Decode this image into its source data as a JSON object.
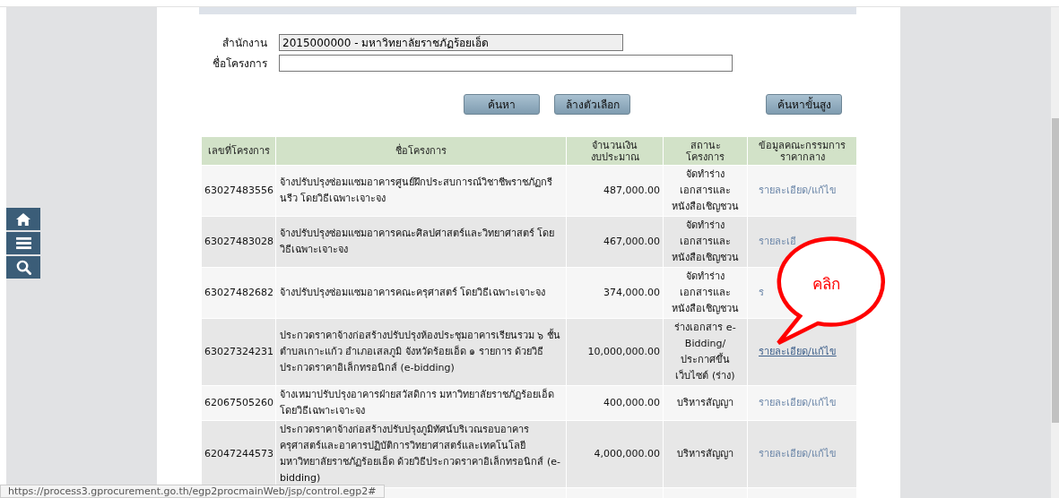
{
  "side_nav": [
    {
      "kind": "home"
    },
    {
      "kind": "menu"
    },
    {
      "kind": "search"
    }
  ],
  "search_form": {
    "fields": [
      {
        "label": "สำนักงาน",
        "value": "2015000000 - มหาวิทยาลัยราชภัฏร้อยเอ็ด",
        "readonly": true
      },
      {
        "label": "ชื่อโครงการ",
        "readonly": false
      }
    ],
    "buttons": [
      "ค้นหา",
      "ล้างตัวเลือก",
      "ค้นหาขั้นสูง"
    ]
  },
  "table": {
    "columns": [
      "เลขที่โครงการ",
      "ชื่อโครงการ",
      "จำนวนเงิน\nงบประมาณ",
      "สถานะ\nโครงการ",
      "ข้อมูลคณะกรรมการ\nราคากลาง"
    ],
    "rows": [
      {
        "id": "63027483556",
        "name": "จ้างปรับปรุงซ่อมแซมอาคารศูนย์ฝึกประสบการณ์วิชาชีพราชภัฏกรีนรีว โดยวิธีเฉพาะเจาะจง",
        "budget": "487,000.00",
        "status": "จัดทำร่าง\nเอกสารและ\nหนังสือเชิญชวน",
        "link": {
          "text": "รายละเอียด/แก้ไข",
          "hovered": false
        }
      },
      {
        "id": "63027483028",
        "name": "จ้างปรับปรุงซ่อมแซมอาคารคณะศิลปศาสตร์และวิทยาศาสตร์ โดยวิธีเฉพาะเจาะจง",
        "budget": "467,000.00",
        "status": "จัดทำร่าง\nเอกสารและ\nหนังสือเชิญชวน",
        "link": {
          "text": "รายละเอี",
          "hovered": false
        }
      },
      {
        "id": "63027482682",
        "name": "จ้างปรับปรุงซ่อมแซมอาคารคณะครุศาสตร์ โดยวิธีเฉพาะเจาะจง",
        "budget": "374,000.00",
        "status": "จัดทำร่าง\nเอกสารและ\nหนังสือเชิญชวน",
        "link": {
          "text": "ร",
          "hovered": false
        }
      },
      {
        "id": "63027324231",
        "name": "ประกวดราคาจ้างก่อสร้างปรับปรุงห้องประชุมอาคารเรียนรวม ๖ ชั้น ตำบลเกาะแก้ว อำเภอเสลภูมิ จังหวัดร้อยเอ็ด ๑ รายการ ด้วยวิธีประกวดราคาอิเล็กทรอนิกส์ (e-bidding)",
        "budget": "10,000,000.00",
        "status": "ร่างเอกสาร e-\nBidding/\nประกาศขึ้น\nเว็บไซต์ (ร่าง)",
        "link": {
          "text": "รายละเอียด/แก้ไข",
          "hovered": true
        }
      },
      {
        "id": "62067505260",
        "name": "จ้างเหมาปรับปรุงอาคารฝ่ายสวัสดิการ มหาวิทยาลัยราชภัฏร้อยเอ็ด โดยวิธีเฉพาะเจาะจง",
        "budget": "400,000.00",
        "status": "บริหารสัญญา",
        "link": {
          "text": "รายละเอียด/แก้ไข",
          "hovered": false
        }
      },
      {
        "id": "62047244573",
        "name": "ประกวดราคาจ้างก่อสร้างปรับปรุงภูมิทัศน์บริเวณรอบอาคารครุศาสตร์และอาคารปฏิบัติการวิทยาศาสตร์และเทคโนโลยีมหาวิทยาลัยราชภัฏร้อยเอ็ด ด้วยวิธีประกวดราคาอิเล็กทรอนิกส์ (e-bidding)",
        "budget": "4,000,000.00",
        "status": "บริหารสัญญา",
        "link": {
          "text": "รายละเอียด/แก้ไข",
          "hovered": false
        }
      },
      {}
    ]
  },
  "callout": {
    "text": "คลิก"
  },
  "status_url": "https://process3.gprocurement.go.th/egp2procmainWeb/jsp/control.egp2#"
}
